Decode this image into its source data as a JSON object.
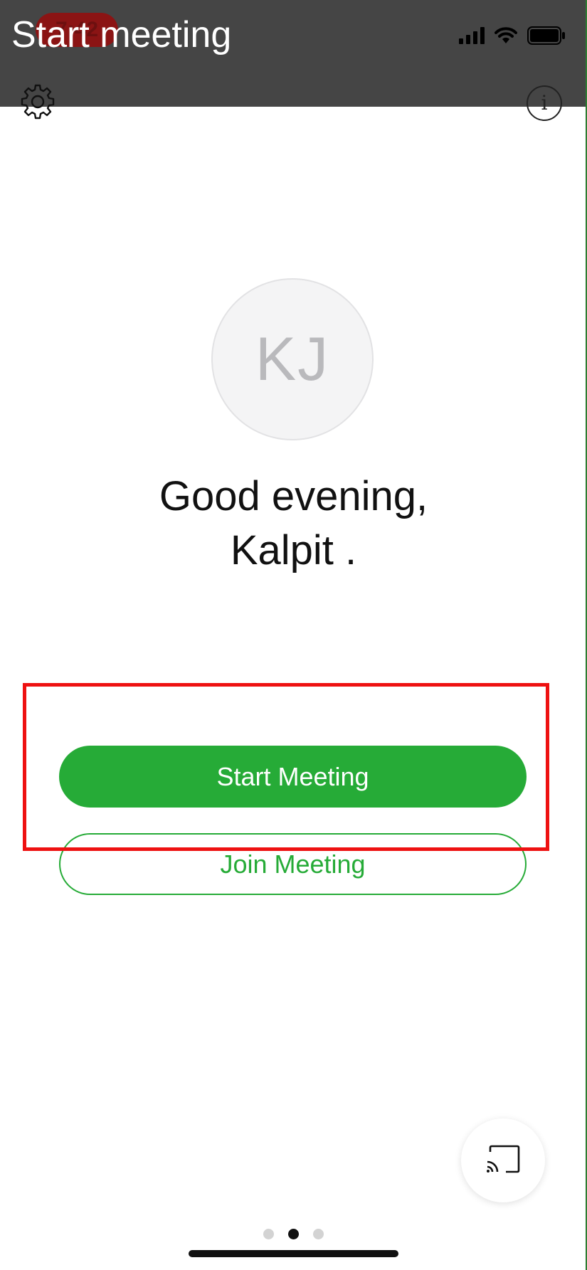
{
  "status_bar": {
    "time": "7:42",
    "icons": [
      "cellular-signal-icon",
      "wifi-icon",
      "battery-icon"
    ]
  },
  "header": {
    "title": "Start meeting",
    "left_icon": "gear-icon",
    "right_icon": "info-icon",
    "info_glyph": "i"
  },
  "profile": {
    "initials": "KJ"
  },
  "greeting": {
    "line1": "Good evening,",
    "line2": "Kalpit ."
  },
  "actions": {
    "start_label": "Start Meeting",
    "join_label": "Join Meeting"
  },
  "cast": {
    "icon": "screen-cast-icon"
  },
  "pager": {
    "count": 3,
    "active_index": 1
  },
  "colors": {
    "accent": "#26ab37",
    "header_bg": "#454545",
    "highlight": "#ee1111",
    "time_pill": "#8b1414"
  }
}
